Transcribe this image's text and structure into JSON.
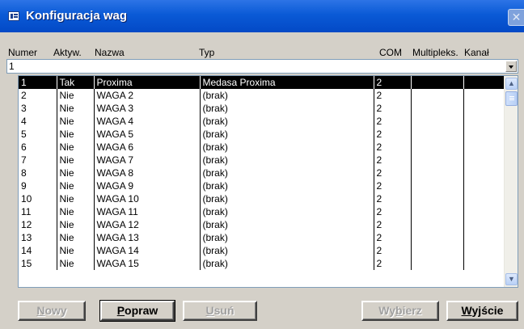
{
  "window": {
    "title": "Konfiguracja wag",
    "close_glyph": "✕"
  },
  "columns": [
    "Numer",
    "Aktyw.",
    "Nazwa",
    "Typ",
    "COM",
    "Multipleks.",
    "Kanał"
  ],
  "combo": {
    "value": "1"
  },
  "rows": [
    [
      "1",
      "Tak",
      "Proxima",
      "Medasa Proxima",
      "2",
      "",
      ""
    ],
    [
      "2",
      "Nie",
      "WAGA 2",
      "(brak)",
      "2",
      "",
      ""
    ],
    [
      "3",
      "Nie",
      "WAGA 3",
      "(brak)",
      "2",
      "",
      ""
    ],
    [
      "4",
      "Nie",
      "WAGA 4",
      "(brak)",
      "2",
      "",
      ""
    ],
    [
      "5",
      "Nie",
      "WAGA 5",
      "(brak)",
      "2",
      "",
      ""
    ],
    [
      "6",
      "Nie",
      "WAGA 6",
      "(brak)",
      "2",
      "",
      ""
    ],
    [
      "7",
      "Nie",
      "WAGA 7",
      "(brak)",
      "2",
      "",
      ""
    ],
    [
      "8",
      "Nie",
      "WAGA 8",
      "(brak)",
      "2",
      "",
      ""
    ],
    [
      "9",
      "Nie",
      "WAGA 9",
      "(brak)",
      "2",
      "",
      ""
    ],
    [
      "10",
      "Nie",
      "WAGA 10",
      "(brak)",
      "2",
      "",
      ""
    ],
    [
      "11",
      "Nie",
      "WAGA 11",
      "(brak)",
      "2",
      "",
      ""
    ],
    [
      "12",
      "Nie",
      "WAGA 12",
      "(brak)",
      "2",
      "",
      ""
    ],
    [
      "13",
      "Nie",
      "WAGA 13",
      "(brak)",
      "2",
      "",
      ""
    ],
    [
      "14",
      "Nie",
      "WAGA 14",
      "(brak)",
      "2",
      "",
      ""
    ],
    [
      "15",
      "Nie",
      "WAGA 15",
      "(brak)",
      "2",
      "",
      ""
    ]
  ],
  "selected_row": 0,
  "buttons": {
    "nowy": {
      "pre": "",
      "key": "N",
      "post": "owy"
    },
    "popraw": {
      "pre": "",
      "key": "P",
      "post": "opraw"
    },
    "usun": {
      "pre": "",
      "key": "U",
      "post": "suń"
    },
    "wybierz": {
      "pre": "Wy",
      "key": "b",
      "post": "ierz"
    },
    "wyjscie": {
      "pre": "",
      "key": "W",
      "post": "yjście"
    }
  },
  "icons": {
    "window": "form-icon",
    "close": "close-icon",
    "dropdown": "chevron-down-icon",
    "scroll_up": "arrow-up-icon",
    "scroll_down": "arrow-down-icon"
  },
  "colors": {
    "titlebar": "#0a5ad6",
    "window_bg": "#d4d0c8",
    "selected_row_bg": "#000000",
    "selected_row_fg": "#ffffff"
  }
}
